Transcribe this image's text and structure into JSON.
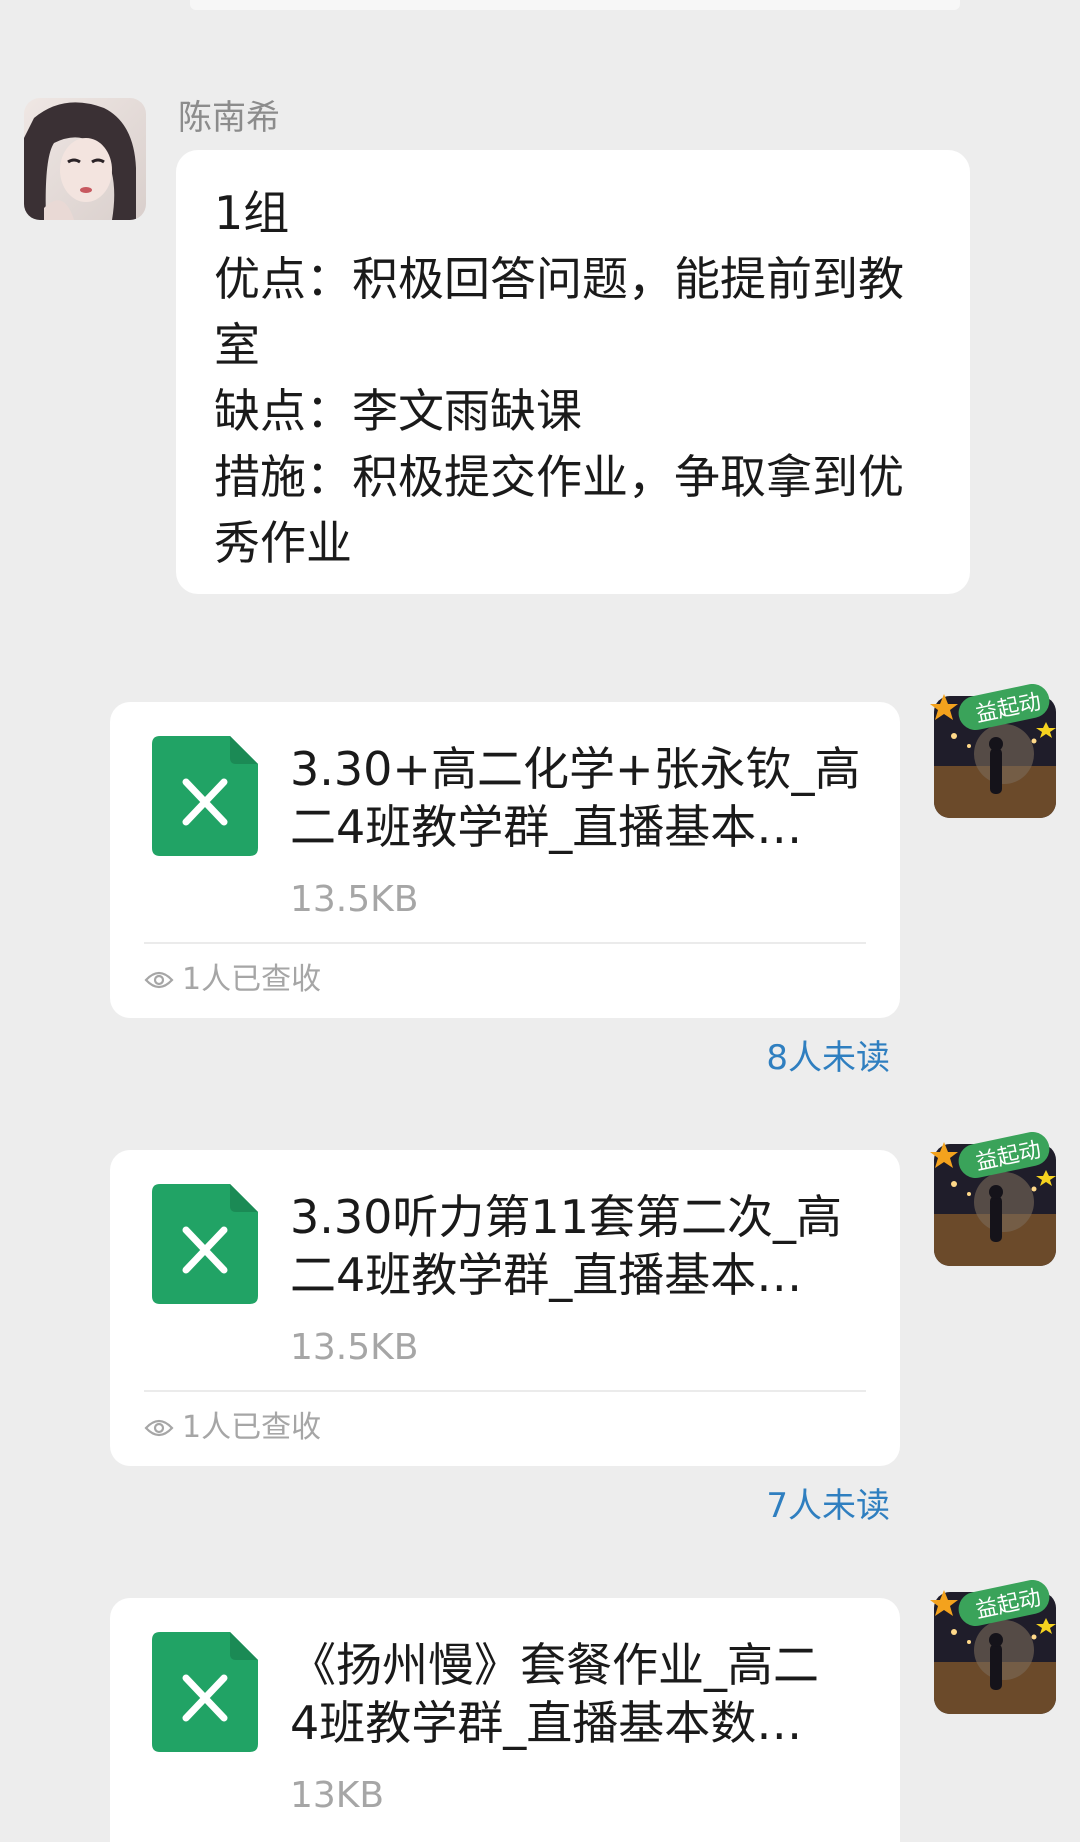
{
  "colors": {
    "background": "#ededed",
    "bubble": "#ffffff",
    "excel_green": "#21a365",
    "unread_blue": "#2f7fc0",
    "muted_text": "#a6a6a6"
  },
  "messages": [
    {
      "type": "text",
      "sender": "陈南希",
      "lines": [
        "1组",
        "优点：积极回答问题，能提前到教",
        "室",
        "缺点：李文雨缺课",
        "措施：积极提交作业，争取拿到优",
        "秀作业"
      ]
    },
    {
      "type": "file",
      "file_icon": "excel-file-icon",
      "title_lines": [
        "3.30+高二化学+张永钦_高",
        "二4班教学群_直播基本…"
      ],
      "size": "13.5KB",
      "read_status": "1人已查收",
      "unread": "8人未读",
      "sticker": "益起动"
    },
    {
      "type": "file",
      "file_icon": "excel-file-icon",
      "title_lines": [
        "3.30听力第11套第二次_高",
        "二4班教学群_直播基本…"
      ],
      "size": "13.5KB",
      "read_status": "1人已查收",
      "unread": "7人未读",
      "sticker": "益起动"
    },
    {
      "type": "file",
      "file_icon": "excel-file-icon",
      "title_lines": [
        "《扬州慢》套餐作业_高二",
        "4班教学群_直播基本数…"
      ],
      "size": "13KB",
      "sticker": "益起动"
    }
  ]
}
